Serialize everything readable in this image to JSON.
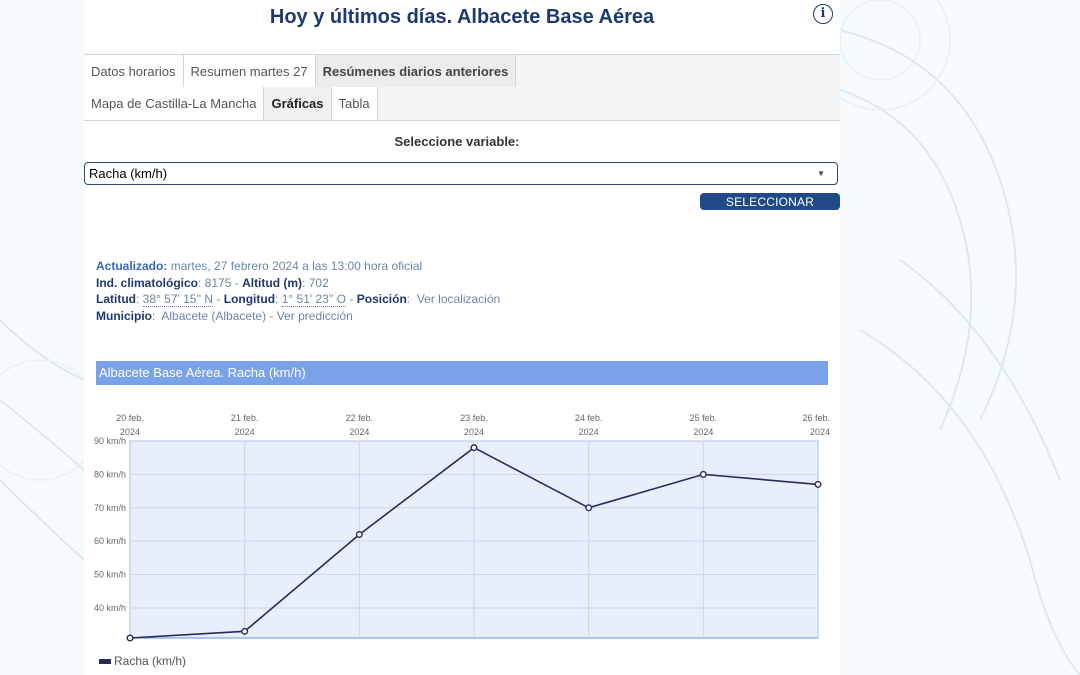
{
  "header": {
    "title": "Hoy y últimos días. Albacete Base Aérea",
    "info_icon": "info-icon"
  },
  "tabs_primary": [
    {
      "label": "Datos horarios",
      "active": false
    },
    {
      "label": "Resumen martes 27",
      "active": false
    },
    {
      "label": "Resúmenes diarios anteriores",
      "active": true
    }
  ],
  "tabs_secondary": [
    {
      "label": "Mapa de Castilla-La Mancha",
      "active": false
    },
    {
      "label": "Gráficas",
      "active": true
    },
    {
      "label": "Tabla",
      "active": false
    }
  ],
  "variable_selector": {
    "label": "Seleccione variable:",
    "selected": "Racha (km/h)",
    "button_label": "SELECCIONAR"
  },
  "station_info": {
    "updated_label": "Actualizado:",
    "updated_value": "martes, 27 febrero 2024 a las 13:00 hora oficial",
    "climate_index_label": "Ind. climatológico",
    "climate_index_value": ": 8175 -",
    "altitude_label": "Altitud (m)",
    "altitude_value": ": 702",
    "latitude_label": "Latitud",
    "latitude_value": "38° 57' 15'' N",
    "longitude_label": "Longitud",
    "longitude_value": "1° 51' 23'' O",
    "position_label": "Posición",
    "position_link": "Ver localización",
    "municipality_label": "Municipio",
    "municipality_value": "Albacete (Albacete)",
    "forecast_link": "Ver predicción"
  },
  "chart_title": "Albacete Base Aérea. Racha (km/h)",
  "chart_data": {
    "type": "line",
    "title": "Albacete Base Aérea. Racha (km/h)",
    "x": [
      "20 feb. 2024",
      "21 feb. 2024",
      "22 feb. 2024",
      "23 feb. 2024",
      "24 feb. 2024",
      "25 feb. 2024",
      "26 feb. 2024"
    ],
    "x_tick_labels": [
      [
        "20 feb.",
        "2024"
      ],
      [
        "21 feb.",
        "2024"
      ],
      [
        "22 feb.",
        "2024"
      ],
      [
        "23 feb.",
        "2024"
      ],
      [
        "24 feb.",
        "2024"
      ],
      [
        "25 feb.",
        "2024"
      ],
      [
        "26 feb.",
        "2024"
      ]
    ],
    "series": [
      {
        "name": "Racha (km/h)",
        "values": [
          31,
          33,
          62,
          88,
          70,
          80,
          77
        ],
        "color": "#2a2a5a"
      }
    ],
    "y_ticks": [
      "90 km/h",
      "80 km/h",
      "70 km/h",
      "60 km/h",
      "50 km/h",
      "40 km/h"
    ],
    "y_tick_values": [
      90,
      80,
      70,
      60,
      50,
      40
    ],
    "ylim": [
      31,
      90
    ],
    "grid": true,
    "x_axis_position": "top",
    "plot_background": "#e8effc",
    "legend_placement": "bottom-left"
  },
  "colors": {
    "title": "#1d3a70",
    "button": "#1f4a86",
    "chart_header": "#7aa2e8",
    "series": "#2a2a5a"
  }
}
